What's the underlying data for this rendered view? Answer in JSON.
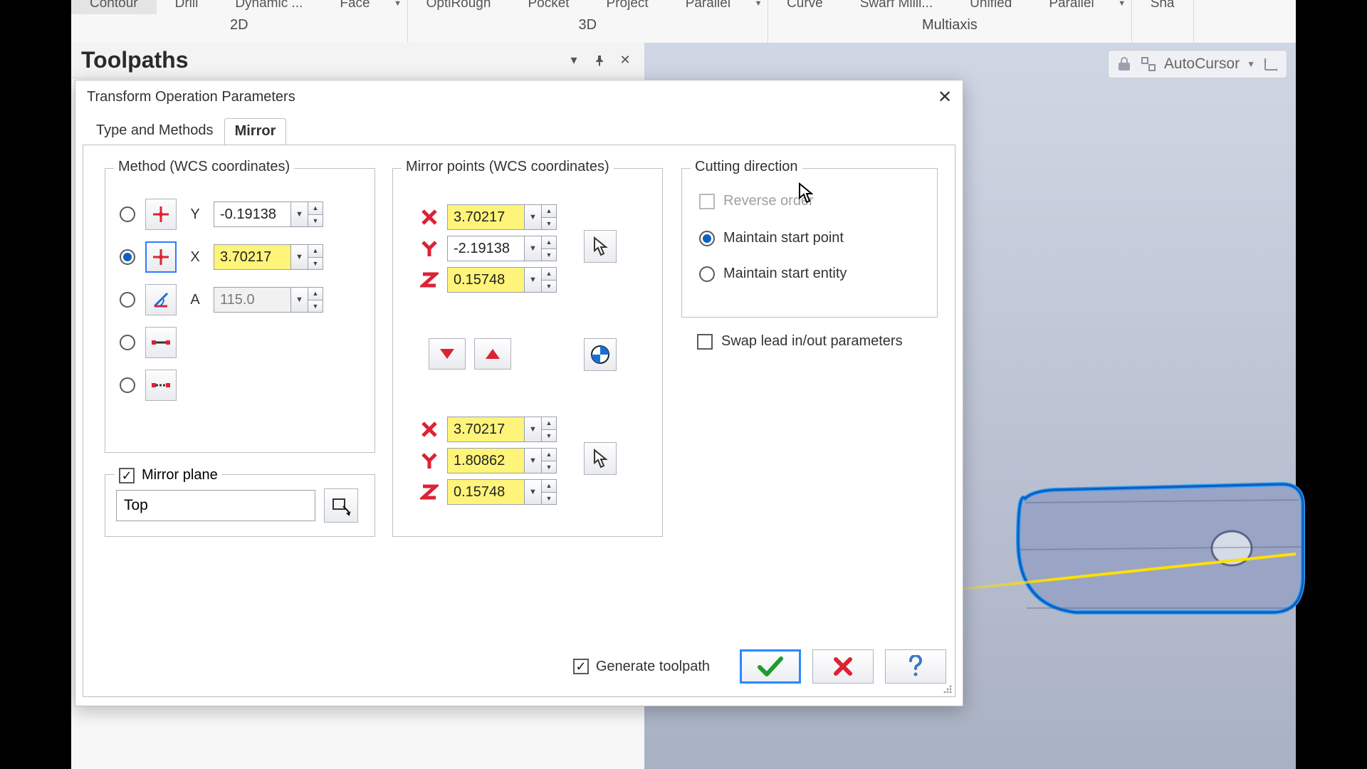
{
  "ribbon": {
    "groups": [
      {
        "label": "2D",
        "tabs": [
          "Contour",
          "Drill",
          "Dynamic ...",
          "Face"
        ],
        "active": 0,
        "dropdown": true
      },
      {
        "label": "3D",
        "tabs": [
          "OptiRough",
          "Pocket",
          "Project",
          "Parallel"
        ],
        "active": -1,
        "dropdown": true
      },
      {
        "label": "Multiaxis",
        "tabs": [
          "Curve",
          "Swarf Milli...",
          "Unified",
          "Parallel"
        ],
        "active": -1,
        "dropdown": true
      },
      {
        "label": "",
        "tabs": [
          "Sha"
        ],
        "active": -1,
        "dropdown": false
      }
    ]
  },
  "panel": {
    "title": "Toolpaths"
  },
  "autocursor": {
    "label": "AutoCursor"
  },
  "dialog": {
    "title": "Transform Operation Parameters",
    "tabs": [
      "Type and Methods",
      "Mirror"
    ],
    "active_tab": 1,
    "method": {
      "legend": "Method (WCS coordinates)",
      "selected": 1,
      "rows": [
        {
          "axis": "Y",
          "value": "-0.19138",
          "hl": false,
          "enabled": true
        },
        {
          "axis": "X",
          "value": "3.70217",
          "hl": true,
          "enabled": true
        },
        {
          "axis": "A",
          "value": "115.0",
          "hl": false,
          "enabled": false
        }
      ]
    },
    "plane": {
      "label": "Mirror plane",
      "checked": true,
      "value": "Top"
    },
    "mirror": {
      "legend": "Mirror points (WCS coordinates)",
      "p1": {
        "X": "3.70217",
        "Y": "-2.19138",
        "Z": "0.15748"
      },
      "p2": {
        "X": "3.70217",
        "Y": "1.80862",
        "Z": "0.15748"
      }
    },
    "cut": {
      "legend": "Cutting direction",
      "reverse": {
        "label": "Reverse order",
        "checked": false,
        "enabled": false
      },
      "maintain_point": {
        "label": "Maintain start point",
        "selected": true
      },
      "maintain_entity": {
        "label": "Maintain start entity",
        "selected": false
      }
    },
    "swap": {
      "label": "Swap lead in/out parameters",
      "checked": false
    },
    "generate": {
      "label": "Generate toolpath",
      "checked": true
    }
  }
}
